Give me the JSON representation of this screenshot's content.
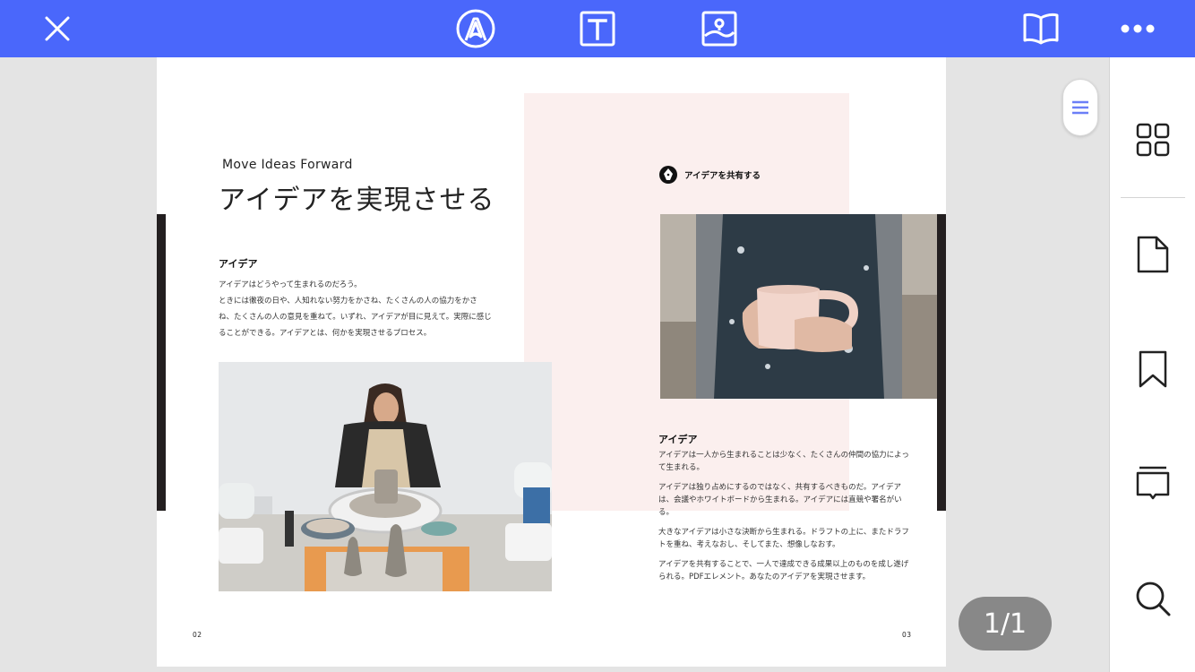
{
  "toolbar": {
    "icons": [
      "close-icon",
      "annotate-icon",
      "text-tool-icon",
      "image-tool-icon",
      "reading-mode-icon",
      "more-icon"
    ],
    "accent_color": "#4a67fb"
  },
  "document": {
    "left_page": {
      "subtitle": "Move Ideas Forward",
      "title": "アイデアを実現させる",
      "heading": "アイデア",
      "paragraphs": [
        "アイデアはどうやって生まれるのだろう。",
        "ときには徹夜の日や、人知れない努力をかさね、たくさんの人の協力をかさね、たくさんの人の意見を重ねて。いずれ、アイデアが目に見えて。実際に感じることができる。アイデアとは、何かを実現させるプロセス。"
      ],
      "page_number": "02"
    },
    "right_page": {
      "share_label": "アイデアを共有する",
      "heading": "アイデア",
      "paragraphs": [
        "アイデアは一人から生まれることは少なく、たくさんの仲間の協力によって生まれる。",
        "アイデアは独り占めにするのではなく、共有するべきものだ。アイデアは、会議やホワイトボードから生まれる。アイデアには直競や署名がいる。",
        "大きなアイデアは小さな決断から生まれる。ドラフトの上に、またドラフトを重ね、考えなおし、そしてまた、想像しなおす。",
        "アイデアを共有することで、一人で達成できる成果以上のものを成し遂げられる。PDFエレメント。あなたのアイデアを実現させます。"
      ],
      "page_number": "03"
    }
  },
  "page_indicator": "1/1",
  "sidebar": {
    "icons": [
      "grid-view-icon",
      "page-icon",
      "bookmark-icon",
      "comments-icon",
      "search-icon"
    ]
  }
}
